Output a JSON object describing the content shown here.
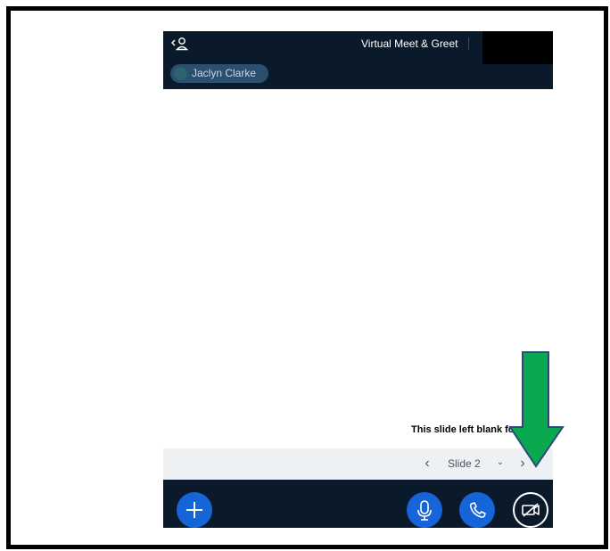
{
  "header": {
    "title": "Virtual Meet & Greet",
    "presenter_name": "Jaclyn Clarke",
    "back_user_icon": "back-user-icon"
  },
  "slide": {
    "text": "This slide left blank for yo up"
  },
  "slide_nav": {
    "prev_icon": "chevron-left-icon",
    "current_label": "Slide 2",
    "dropdown_icon": "chevron-down-icon",
    "next_icon": "chevron-right-icon"
  },
  "bottom_controls": {
    "add_icon": "plus-icon",
    "mic_icon": "microphone-icon",
    "phone_icon": "phone-icon",
    "camera_icon": "camera-off-icon"
  },
  "colors": {
    "bar_dark": "#0b1a2b",
    "accent_blue": "#1565d8",
    "nav_bg": "#eef1f4",
    "arrow_green": "#0aa84f",
    "arrow_border": "#2a4a7a"
  }
}
